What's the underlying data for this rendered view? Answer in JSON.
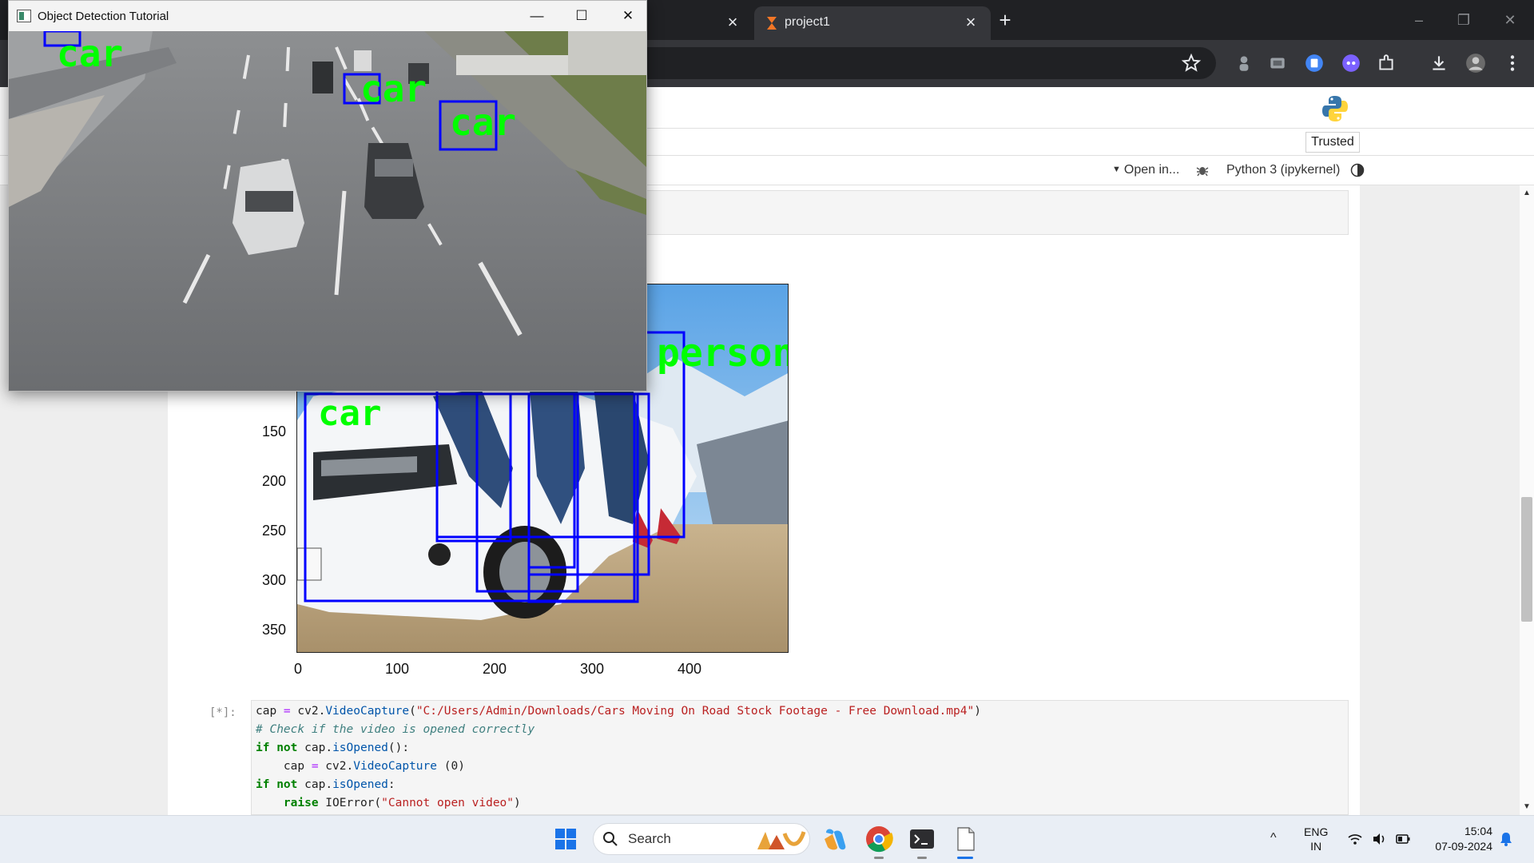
{
  "browser": {
    "tabs": [
      {
        "label": ""
      },
      {
        "label": "project1",
        "active": true
      }
    ],
    "new_tab_symbol": "+",
    "tab_close_symbol": "×",
    "window_controls": [
      "–",
      "❐",
      "✕"
    ],
    "extension_icons": [
      "profile-icon",
      "cast-icon",
      "docs-extension-icon",
      "discord-extension-icon",
      "puzzle-icon",
      "download-icon",
      "avatar",
      "kebab-menu-icon"
    ]
  },
  "jupyter": {
    "trusted_label": "Trusted",
    "open_in_label": "Open in...",
    "kernel_label": "Python 3 (ipykernel)",
    "accent_color": "#f37626"
  },
  "output_plot": {
    "y_ticks": [
      "150",
      "200",
      "250",
      "300",
      "350"
    ],
    "x_ticks": [
      "0",
      "100",
      "200",
      "300",
      "400"
    ],
    "detection_labels": [
      "car",
      "person"
    ]
  },
  "code_cell": {
    "prompt": "[*]:",
    "lines": [
      "cap = cv2.VideoCapture(\"C:/Users/Admin/Downloads/Cars Moving On Road Stock Footage - Free Download.mp4\")",
      "# Check if the video is opened correctly",
      "if not cap.isOpened():",
      "    cap = cv2.VideoCapture (0)",
      "if not cap.isOpened:",
      "    raise IOError(\"Cannot open video\")"
    ]
  },
  "cv_window": {
    "title": "Object Detection Tutorial",
    "controls": [
      "—",
      "☐",
      "✕"
    ],
    "detection_label": "car",
    "box_color": "#0000ff",
    "label_color": "#00ff00"
  },
  "taskbar": {
    "search_label": "Search",
    "language": "ENG",
    "region": "IN",
    "time": "15:04",
    "date": "07-09-2024",
    "tray_chevron": "^"
  }
}
